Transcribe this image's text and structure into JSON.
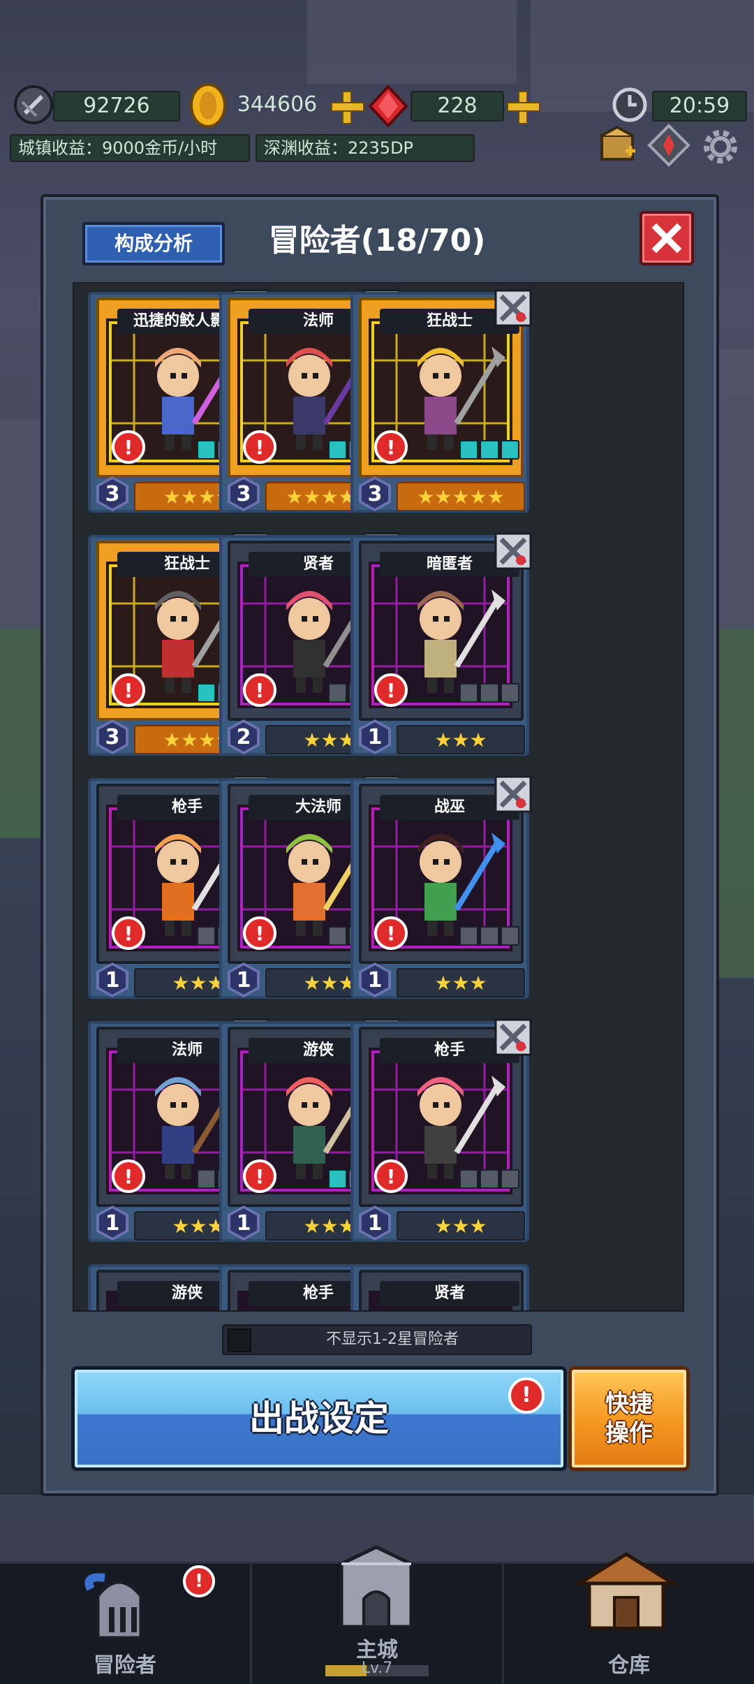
{
  "hud": {
    "power": "92726",
    "gold": "344606",
    "gems": "228",
    "clock": "20:59",
    "town_income": "城镇收益：9000金币/小时",
    "abyss_income": "深渊收益：2235DP"
  },
  "panel": {
    "analysis_label": "构成分析",
    "title": "冒险者(18/70)",
    "toggle_label": "不显示1-2星冒险者",
    "battle_label": "出战设定",
    "quick_label_line1": "快捷",
    "quick_label_line2": "操作"
  },
  "cards": [
    {
      "name": "迅捷的鲛人影者",
      "level": "3",
      "stars": "★★★★",
      "rarity": "gold",
      "hair": "#f0a878",
      "outfit": "#4a66c8",
      "weapon": "#d060e0"
    },
    {
      "name": "法师",
      "level": "3",
      "stars": "★★★★★",
      "rarity": "gold",
      "hair": "#e05050",
      "outfit": "#3a3a6a",
      "weapon": "#6a3aa0"
    },
    {
      "name": "狂战士",
      "level": "3",
      "stars": "★★★★★",
      "rarity": "gold",
      "hair": "#f0c030",
      "outfit": "#8a4a8a",
      "weapon": "#a0a0a0"
    },
    {
      "name": "狂战士",
      "level": "3",
      "stars": "★★★★",
      "rarity": "gold",
      "hair": "#606060",
      "outfit": "#c03030",
      "weapon": "#a0a0a0"
    },
    {
      "name": "贤者",
      "level": "2",
      "stars": "★★★",
      "rarity": "blue",
      "hair": "#e05070",
      "outfit": "#303030",
      "weapon": "#909090"
    },
    {
      "name": "暗匿者",
      "level": "1",
      "stars": "★★★",
      "rarity": "blue",
      "hair": "#9a6a50",
      "outfit": "#c0b080",
      "weapon": "#e0e0e0"
    },
    {
      "name": "枪手",
      "level": "1",
      "stars": "★★★",
      "rarity": "blue",
      "hair": "#f0a050",
      "outfit": "#e07020",
      "weapon": "#e0e0e0"
    },
    {
      "name": "大法师",
      "level": "1",
      "stars": "★★★",
      "rarity": "blue",
      "hair": "#90c040",
      "outfit": "#e07030",
      "weapon": "#f0d060"
    },
    {
      "name": "战巫",
      "level": "1",
      "stars": "★★★",
      "rarity": "blue",
      "hair": "#402020",
      "outfit": "#40a050",
      "weapon": "#4090f0"
    },
    {
      "name": "法师",
      "level": "1",
      "stars": "★★★",
      "rarity": "blue",
      "hair": "#70a0d0",
      "outfit": "#304080",
      "weapon": "#8a5a30"
    },
    {
      "name": "游侠",
      "level": "1",
      "stars": "★★★",
      "rarity": "blue",
      "hair": "#f06060",
      "outfit": "#306050",
      "weapon": "#d0c0a0"
    },
    {
      "name": "枪手",
      "level": "1",
      "stars": "★★★",
      "rarity": "blue",
      "hair": "#f06080",
      "outfit": "#404040",
      "weapon": "#e0e0e0"
    }
  ],
  "partial_cards": [
    "游侠",
    "枪手",
    "贤者"
  ],
  "nav": {
    "adventurer": "冒险者",
    "main_city": "主城",
    "main_city_level": "Lv.7",
    "storage": "仓库"
  },
  "colors": {
    "gold_card": "#f0a020",
    "blue_card": "#3b5a80",
    "alert": "#e02a2a",
    "battle_button": "#3e78d0",
    "quick_button": "#f59a22"
  }
}
